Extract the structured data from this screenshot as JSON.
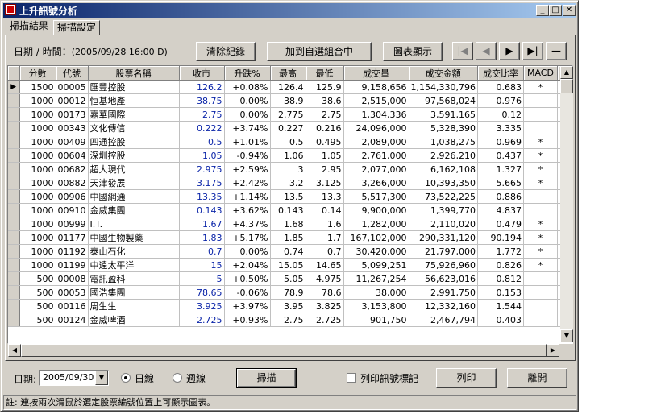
{
  "window": {
    "title": "上升訊號分析"
  },
  "tabs": [
    {
      "label": "掃描結果"
    },
    {
      "label": "掃描設定"
    }
  ],
  "toolbar": {
    "date_label": "日期 / 時間：",
    "date_value": "(2005/09/28 16:00 D)",
    "clear_label": "清除紀錄",
    "add_label": "加到自選組合中",
    "chart_label": "圖表顯示"
  },
  "table": {
    "columns": [
      "分數",
      "代號",
      "股票名稱",
      "收市",
      "升跌%",
      "最高",
      "最低",
      "成交量",
      "成交金額",
      "成交比率",
      "MACD"
    ],
    "rows": [
      [
        "1500",
        "00005",
        "匯豐控股",
        "126.2",
        "+0.08%",
        "126.4",
        "125.9",
        "9,158,656",
        "1,154,330,796",
        "0.683",
        "*"
      ],
      [
        "1000",
        "00012",
        "恒基地產",
        "38.75",
        "0.00%",
        "38.9",
        "38.6",
        "2,515,000",
        "97,568,024",
        "0.976",
        ""
      ],
      [
        "1000",
        "00173",
        "嘉華國際",
        "2.75",
        "0.00%",
        "2.775",
        "2.75",
        "1,304,336",
        "3,591,165",
        "0.12",
        ""
      ],
      [
        "1000",
        "00343",
        "文化傳信",
        "0.222",
        "+3.74%",
        "0.227",
        "0.216",
        "24,096,000",
        "5,328,390",
        "3.335",
        ""
      ],
      [
        "1000",
        "00409",
        "四通控股",
        "0.5",
        "+1.01%",
        "0.5",
        "0.495",
        "2,089,000",
        "1,038,275",
        "0.969",
        "*"
      ],
      [
        "1000",
        "00604",
        "深圳控股",
        "1.05",
        "-0.94%",
        "1.06",
        "1.05",
        "2,761,000",
        "2,926,210",
        "0.437",
        "*"
      ],
      [
        "1000",
        "00682",
        "超大現代",
        "2.975",
        "+2.59%",
        "3",
        "2.95",
        "2,077,000",
        "6,162,108",
        "1.327",
        "*"
      ],
      [
        "1000",
        "00882",
        "天津發展",
        "3.175",
        "+2.42%",
        "3.2",
        "3.125",
        "3,266,000",
        "10,393,350",
        "5.665",
        "*"
      ],
      [
        "1000",
        "00906",
        "中國網通",
        "13.35",
        "+1.14%",
        "13.5",
        "13.3",
        "5,517,300",
        "73,522,225",
        "0.886",
        ""
      ],
      [
        "1000",
        "00910",
        "金威集團",
        "0.143",
        "+3.62%",
        "0.143",
        "0.14",
        "9,900,000",
        "1,399,770",
        "4.837",
        ""
      ],
      [
        "1000",
        "00999",
        "I.T.",
        "1.67",
        "+4.37%",
        "1.68",
        "1.6",
        "1,282,000",
        "2,110,020",
        "0.479",
        "*"
      ],
      [
        "1000",
        "01177",
        "中國生物製藥",
        "1.83",
        "+5.17%",
        "1.85",
        "1.7",
        "167,102,000",
        "290,331,120",
        "90.194",
        "*"
      ],
      [
        "1000",
        "01192",
        "泰山石化",
        "0.7",
        "0.00%",
        "0.74",
        "0.7",
        "30,420,000",
        "21,797,000",
        "1.772",
        "*"
      ],
      [
        "1000",
        "01199",
        "中遠太平洋",
        "15",
        "+2.04%",
        "15.05",
        "14.65",
        "5,099,251",
        "75,926,960",
        "0.826",
        "*"
      ],
      [
        "500",
        "00008",
        "電訊盈科",
        "5",
        "+0.50%",
        "5.05",
        "4.975",
        "11,267,254",
        "56,623,016",
        "0.812",
        ""
      ],
      [
        "500",
        "00053",
        "國浩集團",
        "78.65",
        "-0.06%",
        "78.9",
        "78.6",
        "38,000",
        "2,991,750",
        "0.153",
        ""
      ],
      [
        "500",
        "00116",
        "周生生",
        "3.925",
        "+3.97%",
        "3.95",
        "3.825",
        "3,153,800",
        "12,332,160",
        "1.544",
        ""
      ],
      [
        "500",
        "00124",
        "金威啤酒",
        "2.725",
        "+0.93%",
        "2.75",
        "2.725",
        "901,750",
        "2,467,794",
        "0.403",
        ""
      ]
    ]
  },
  "bottom": {
    "date_label": "日期:",
    "date_value": "2005/09/30",
    "daily_label": "日線",
    "weekly_label": "週線",
    "scan_label": "掃描",
    "print_mark_label": "列印訊號標記",
    "print_label": "列印",
    "exit_label": "離開"
  },
  "status": {
    "text": "註: 連按兩次滑鼠於選定股票編號位置上可顯示圖表。"
  },
  "colors": {
    "title_start": "#0a246a",
    "title_end": "#a6caf0",
    "price_blue": "#0a24a8",
    "face": "#d4d0c8"
  }
}
